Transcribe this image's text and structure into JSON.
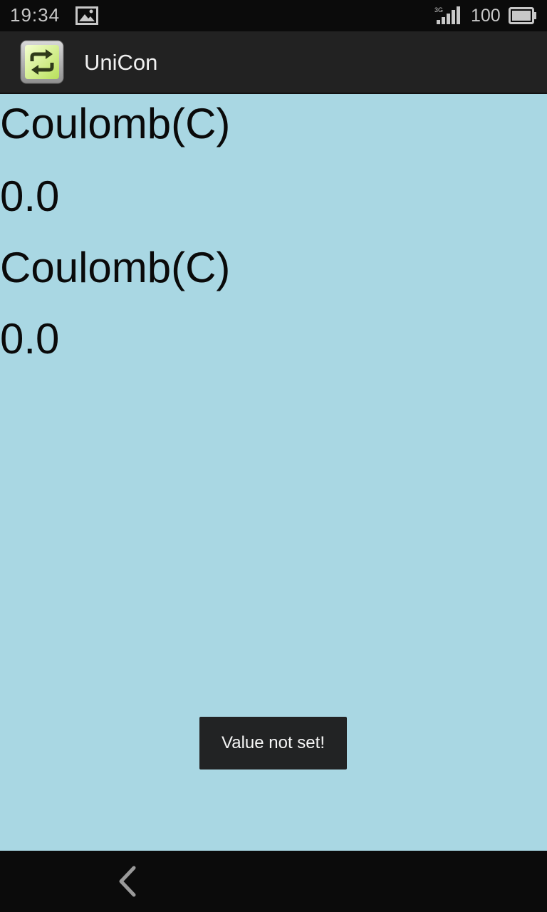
{
  "status_bar": {
    "time": "19:34",
    "network": "3G",
    "battery": "100",
    "icons": [
      "gallery-icon",
      "signal-icon",
      "battery-icon"
    ]
  },
  "action_bar": {
    "title": "UniCon",
    "icon": "refresh-icon"
  },
  "content": {
    "from_unit": "Coulomb(C)",
    "from_value": "0.0",
    "to_unit": "Coulomb(C)",
    "to_value": "0.0",
    "background_color": "#a9d7e3"
  },
  "toast": {
    "message": "Value not set!"
  },
  "nav_bar": {
    "icons": [
      "back-icon"
    ]
  }
}
